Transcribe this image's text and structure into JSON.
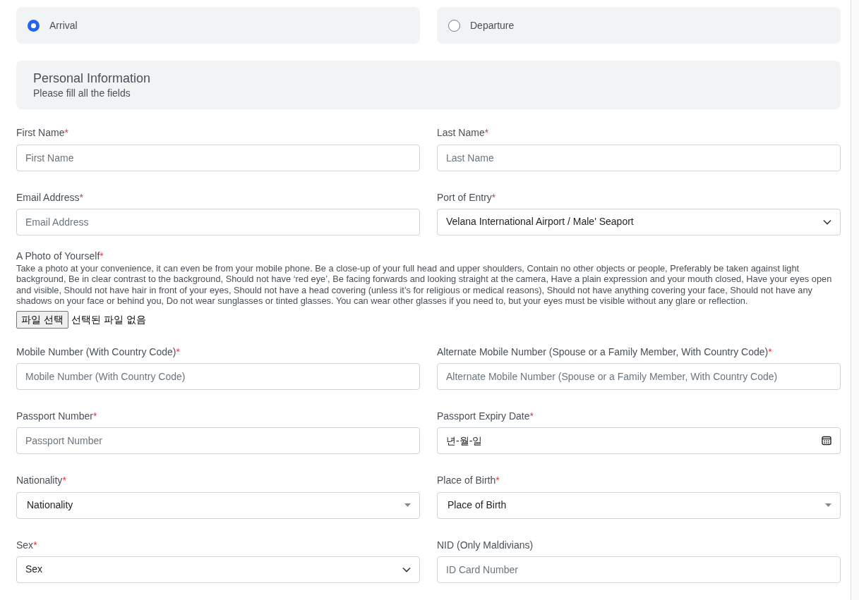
{
  "trip_type": [
    {
      "label": "Arrival",
      "selected": true
    },
    {
      "label": "Departure",
      "selected": false
    }
  ],
  "section": {
    "title": "Personal Information",
    "subtitle": "Please fill all the fields"
  },
  "rows": [
    [
      {
        "kind": "text",
        "label": "First Name",
        "required_mark": "*",
        "placeholder": "First Name"
      },
      {
        "kind": "text",
        "label": "Last Name",
        "required_mark": "*",
        "placeholder": "Last Name"
      }
    ],
    [
      {
        "kind": "text",
        "label": "Email Address",
        "required_mark": "*",
        "placeholder": "Email Address"
      },
      {
        "kind": "select",
        "label": "Port of Entry",
        "required_mark": "*",
        "value": "Velana International Airport / Male' Seaport",
        "native": false
      }
    ],
    [
      {
        "kind": "file",
        "label": "A Photo of Yourself",
        "required_mark": "*",
        "description": "Take a photo at your convenience, it can even be from your mobile phone. Be a close-up of your full head and upper shoulders, Contain no other objects or people, Preferably be taken against light background, Be in clear contrast to the background, Should not have ‘red eye’, Be facing forwards and looking straight at the camera, Have a plain expression and your mouth closed, Have your eyes open and visible, Should not have hair in front of your eyes, Should not have a head covering (unless it’s for religious or medical reasons), Should not have anything covering your face, Should not have any shadows on your face or behind you, Do not wear sunglasses or tinted glasses. You can wear other glasses if you need to, but your eyes must be visible without any glare or reflection.",
        "button": "파일 선택",
        "status": "선택된 파일 없음"
      }
    ],
    [
      {
        "kind": "text",
        "label": "Mobile Number (With Country Code)",
        "required_mark": "*",
        "placeholder": "Mobile Number (With Country Code)"
      },
      {
        "kind": "text",
        "label": "Alternate Mobile Number (Spouse or a Family Member, With Country Code)",
        "required_mark": "*",
        "placeholder": "Alternate Mobile Number (Spouse or a Family Member, With Country Code)"
      }
    ],
    [
      {
        "kind": "text",
        "label": "Passport Number",
        "required_mark": "*",
        "placeholder": "Passport Number"
      },
      {
        "kind": "date",
        "label": "Passport Expiry Date",
        "required_mark": "*",
        "value": "년-월-일"
      }
    ],
    [
      {
        "kind": "select",
        "label": "Nationality",
        "required_mark": "*",
        "value": "Nationality",
        "native": true
      },
      {
        "kind": "select",
        "label": "Place of Birth",
        "required_mark": "*",
        "value": "Place of Birth",
        "native": true
      }
    ],
    [
      {
        "kind": "select",
        "label": "Sex",
        "required_mark": "*",
        "value": "Sex",
        "native": false
      },
      {
        "kind": "text",
        "label": "NID (Only Maldivians)",
        "placeholder": "ID Card Number"
      }
    ]
  ]
}
